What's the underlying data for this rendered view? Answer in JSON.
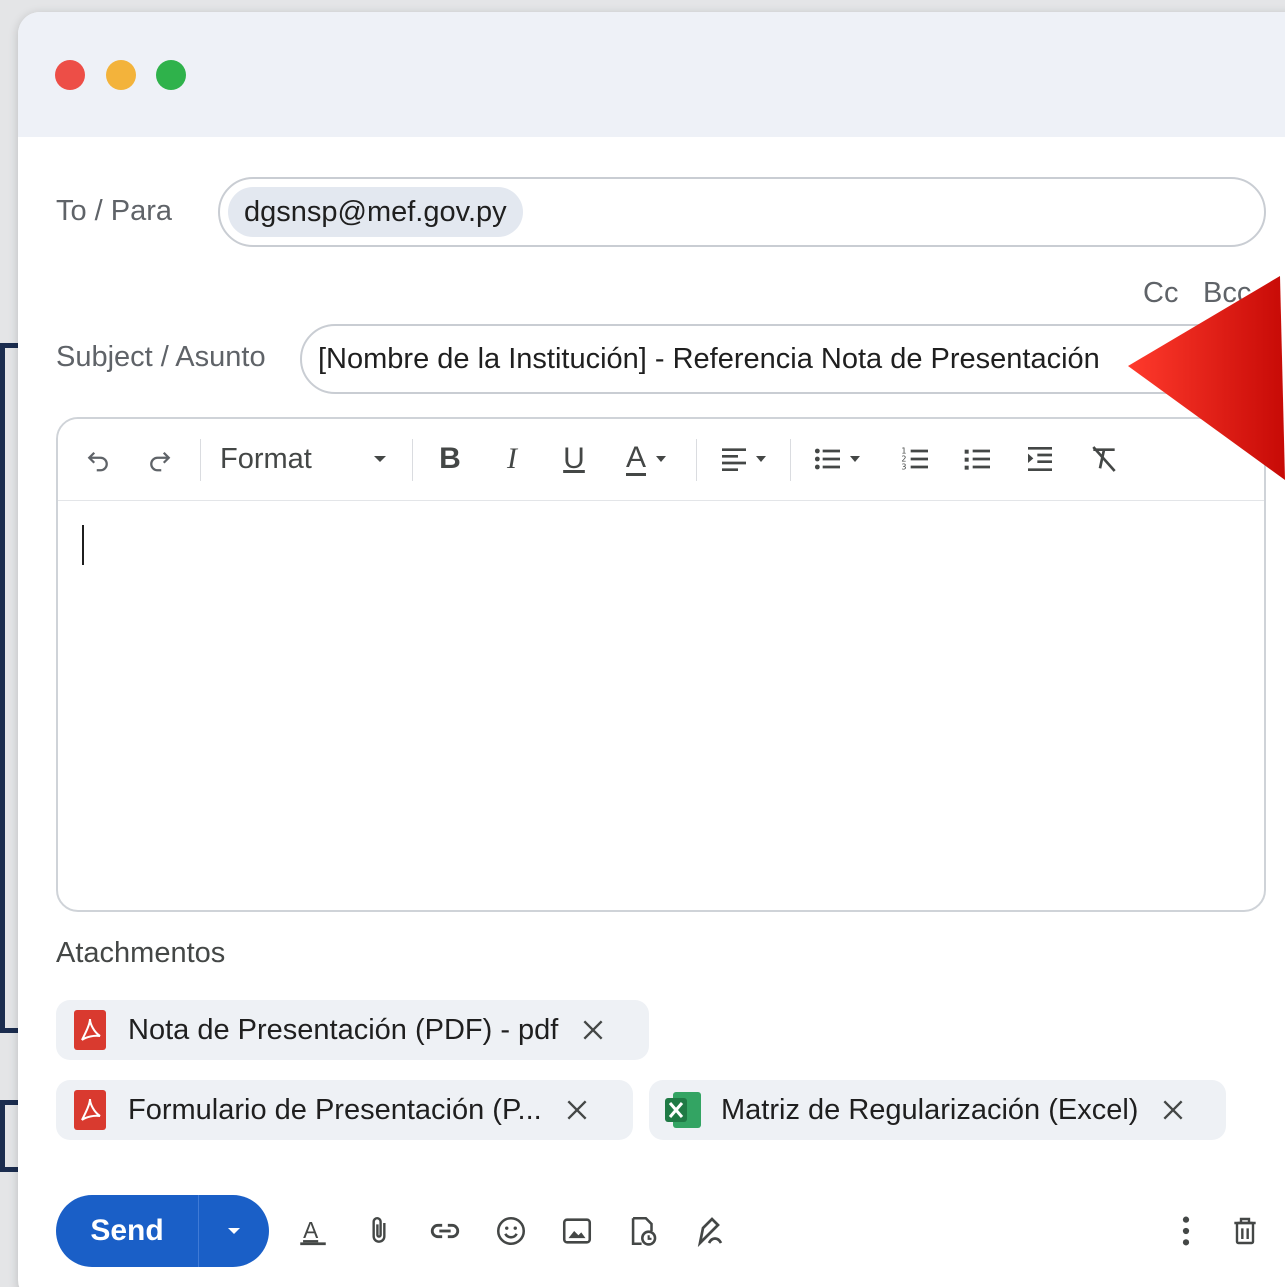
{
  "compose": {
    "to_label": "To / Para",
    "to_recipient": "dgsnsp@mef.gov.py",
    "cc_label": "Cc",
    "bcc_label": "Bcc",
    "subject_label": "Subject / Asunto",
    "subject_value": "[Nombre de la Institución] - Referencia Nota de Presentación"
  },
  "toolbar": {
    "format_label": "Format",
    "bold": "B",
    "italic": "I",
    "underline": "U",
    "text_color": "A"
  },
  "attachments": {
    "title": "Atachmentos",
    "items": [
      {
        "name": "Nota de Presentación (PDF) - pdf",
        "icon": "pdf-icon"
      },
      {
        "name": "Formulario de Presentación (P...",
        "icon": "pdf-icon"
      },
      {
        "name": "Matriz de Regularización (Excel)",
        "icon": "excel-icon"
      }
    ]
  },
  "footer": {
    "send_label": "Send"
  },
  "colors": {
    "send_button": "#1a5fc7",
    "pdf_icon": "#d93a2f",
    "excel_icon": "#1f7a45",
    "annotation_arrow": "#e8130f",
    "connector_lines": "#1b2d4f"
  }
}
